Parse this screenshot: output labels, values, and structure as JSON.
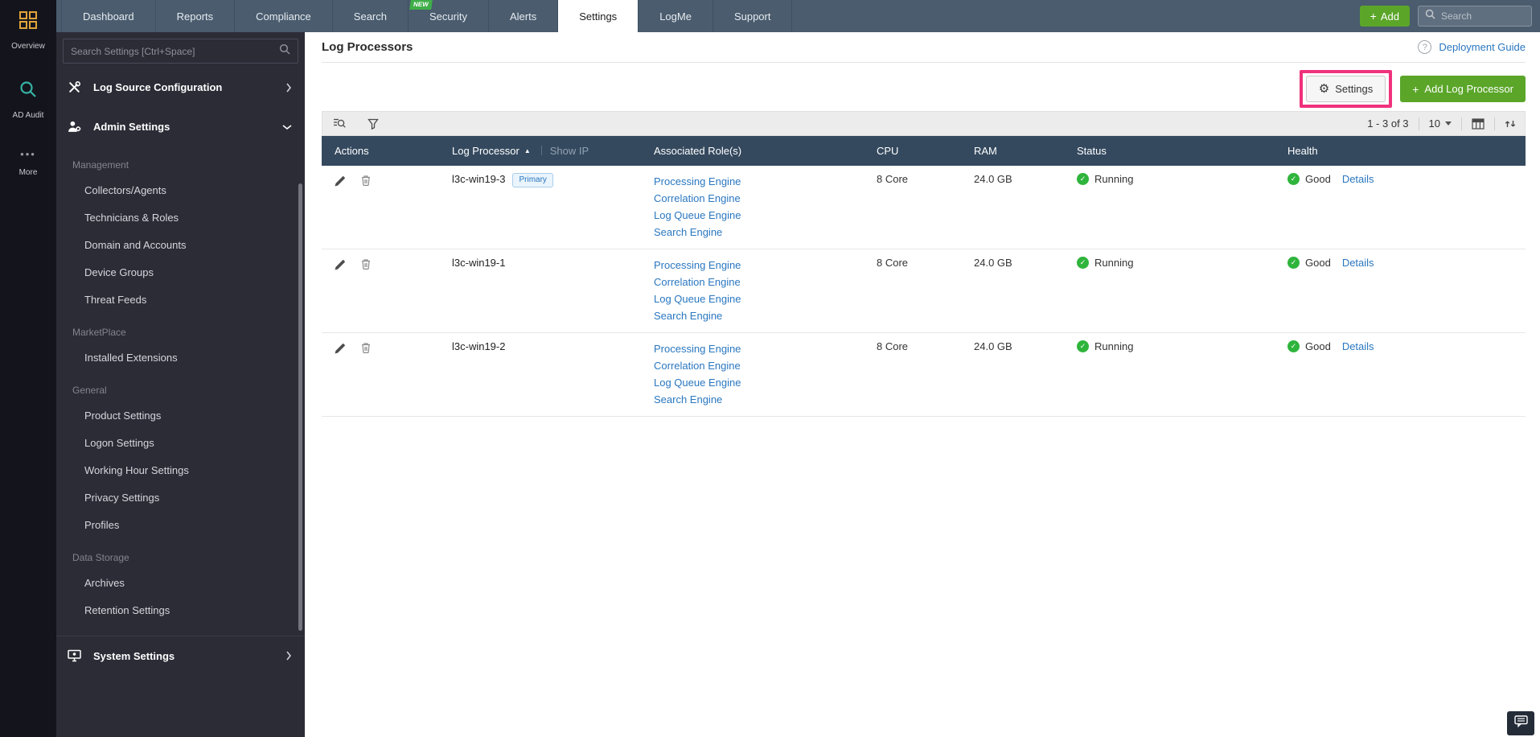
{
  "colors": {
    "topbar": "#4a5c6e",
    "active_tab_bg": "#ffffff",
    "green_button": "#5ba629",
    "table_header": "#34495e",
    "link_blue": "#2a77c0",
    "status_green": "#2fb43c",
    "highlight_pink": "#f0327c",
    "sidebar_bg": "#2c2c37",
    "rail_bg": "#14141c",
    "primary_badge_text": "#2a77c0"
  },
  "topnav": {
    "tabs": [
      {
        "label": "Dashboard"
      },
      {
        "label": "Reports"
      },
      {
        "label": "Compliance"
      },
      {
        "label": "Search"
      },
      {
        "label": "Security",
        "badge": "NEW"
      },
      {
        "label": "Alerts"
      },
      {
        "label": "Settings",
        "active": true
      },
      {
        "label": "LogMe"
      },
      {
        "label": "Support"
      }
    ],
    "add_label": "Add",
    "search_placeholder": "Search"
  },
  "rail": {
    "items": [
      {
        "label": "Overview",
        "icon": "grid-icon"
      },
      {
        "label": "AD Audit",
        "icon": "magnifier-icon"
      },
      {
        "label": "More",
        "icon": "ellipsis-icon"
      }
    ]
  },
  "sidebar": {
    "search_placeholder": "Search Settings [Ctrl+Space]",
    "top_items": [
      {
        "label": "Log Source Configuration",
        "icon": "tools-icon",
        "chevron": "right"
      },
      {
        "label": "Admin Settings",
        "icon": "user-gear-icon",
        "chevron": "down"
      }
    ],
    "sections": [
      {
        "header": "Management",
        "items": [
          "Collectors/Agents",
          "Technicians & Roles",
          "Domain and Accounts",
          "Device Groups",
          "Threat Feeds"
        ]
      },
      {
        "header": "MarketPlace",
        "items": [
          "Installed Extensions"
        ]
      },
      {
        "header": "General",
        "items": [
          "Product Settings",
          "Logon Settings",
          "Working Hour Settings",
          "Privacy Settings",
          "Profiles"
        ]
      },
      {
        "header": "Data Storage",
        "items": [
          "Archives",
          "Retention Settings"
        ]
      }
    ],
    "bottom_item": {
      "label": "System Settings",
      "icon": "system-gear-icon",
      "chevron": "right"
    }
  },
  "main": {
    "title": "Log Processors",
    "help_icon": "?",
    "deployment_guide": "Deployment Guide",
    "settings_button": "Settings",
    "add_log_processor_button": "Add Log Processor",
    "toolbar": {
      "pagination": "1 - 3 of 3",
      "page_size": "10"
    },
    "table": {
      "headers": {
        "actions": "Actions",
        "log_processor": "Log Processor",
        "show_ip": "Show IP",
        "roles": "Associated Role(s)",
        "cpu": "CPU",
        "ram": "RAM",
        "status": "Status",
        "health": "Health"
      },
      "rows": [
        {
          "name": "l3c-win19-3",
          "badge": "Primary",
          "roles": [
            "Processing Engine",
            "Correlation Engine",
            "Log Queue Engine",
            "Search Engine"
          ],
          "cpu": "8 Core",
          "ram": "24.0 GB",
          "status": "Running",
          "health": "Good",
          "details": "Details"
        },
        {
          "name": "l3c-win19-1",
          "roles": [
            "Processing Engine",
            "Correlation Engine",
            "Log Queue Engine",
            "Search Engine"
          ],
          "cpu": "8 Core",
          "ram": "24.0 GB",
          "status": "Running",
          "health": "Good",
          "details": "Details"
        },
        {
          "name": "l3c-win19-2",
          "roles": [
            "Processing Engine",
            "Correlation Engine",
            "Log Queue Engine",
            "Search Engine"
          ],
          "cpu": "8 Core",
          "ram": "24.0 GB",
          "status": "Running",
          "health": "Good",
          "details": "Details"
        }
      ]
    }
  }
}
